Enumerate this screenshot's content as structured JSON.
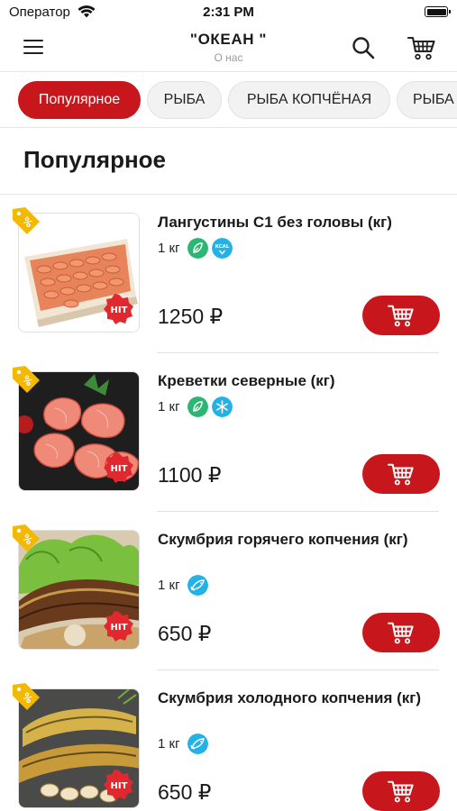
{
  "status_bar": {
    "carrier": "Оператор",
    "time": "2:31 PM",
    "wifi_icon": "wifi-icon",
    "battery_icon": "battery-icon"
  },
  "header": {
    "title": "\"ОКЕАН \"",
    "subtitle": "О нас",
    "menu_icon": "hamburger-menu-icon",
    "search_icon": "search-icon",
    "cart_icon": "shopping-cart-icon"
  },
  "categories": [
    {
      "label": "Популярное",
      "active": true
    },
    {
      "label": "РЫБА",
      "active": false
    },
    {
      "label": "РЫБА КОПЧЁНАЯ",
      "active": false
    },
    {
      "label": "РЫБА",
      "active": false
    }
  ],
  "section": {
    "title": "Популярное"
  },
  "products": [
    {
      "name": "Лангустины С1 без головы (кг)",
      "weight": "1 кг",
      "badges": [
        "leaf-icon",
        "kcal-icon"
      ],
      "price": "1250 ₽",
      "hit_label": "HIT",
      "image": "langoustines-box-image"
    },
    {
      "name": "Креветки северные (кг)",
      "weight": "1 кг",
      "badges": [
        "leaf-icon",
        "snowflake-icon"
      ],
      "price": "1100 ₽",
      "hit_label": "HIT",
      "image": "shrimp-image"
    },
    {
      "name": "Скумбрия горячего копчения (кг)",
      "weight": "1 кг",
      "badges": [
        "fish-icon"
      ],
      "price": "650 ₽",
      "hit_label": "HIT",
      "image": "hot-smoked-mackerel-image"
    },
    {
      "name": "Скумбрия холодного копчения (кг)",
      "weight": "1 кг",
      "badges": [
        "fish-icon"
      ],
      "price": "650 ₽",
      "hit_label": "HIT",
      "image": "cold-smoked-mackerel-image"
    }
  ],
  "colors": {
    "accent": "#c8171c",
    "tag": "#f5b800",
    "badge_green": "#2bb673",
    "badge_blue": "#22b2e6"
  }
}
